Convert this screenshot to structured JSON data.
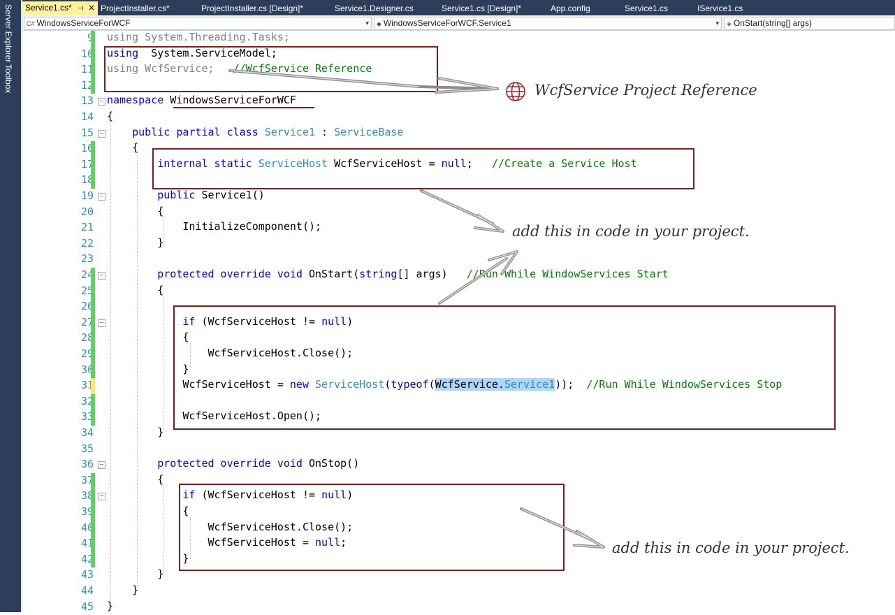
{
  "dock": {
    "server_explorer": "Server Explorer",
    "toolbox": "Toolbox"
  },
  "tabs": [
    {
      "label": "Service1.cs*",
      "active": true
    },
    {
      "label": "ProjectInstaller.cs*"
    },
    {
      "label": "ProjectInstaller.cs [Design]*"
    },
    {
      "label": "Service1.Designer.cs"
    },
    {
      "label": "Service1.cs [Design]*"
    },
    {
      "label": "App.config"
    },
    {
      "label": "Service1.cs"
    },
    {
      "label": "IService1.cs"
    }
  ],
  "tab_pin": "⊣",
  "tab_close": "✕",
  "nav": {
    "project": "WindowsServiceForWCF",
    "class": "WindowsServiceForWCF.Service1",
    "member": "OnStart(string[] args)"
  },
  "lines": [
    {
      "n": "9",
      "code": [
        [
          "gy",
          "using System.Threading.Tasks;"
        ]
      ]
    },
    {
      "n": "10",
      "code": [
        [
          "kw",
          "using"
        ],
        [
          "",
          "  System.ServiceModel;"
        ]
      ]
    },
    {
      "n": "11",
      "code": [
        [
          "gy",
          "using WcfService;"
        ],
        [
          "",
          "   "
        ],
        [
          "cm",
          "//WcfService Reference"
        ]
      ]
    },
    {
      "n": "12",
      "code": []
    },
    {
      "n": "13",
      "code": [
        [
          "kw",
          "namespace"
        ],
        [
          "",
          " WindowsServiceForWCF"
        ]
      ]
    },
    {
      "n": "14",
      "code": [
        [
          "",
          "{"
        ]
      ]
    },
    {
      "n": "15",
      "code": [
        [
          "",
          "    "
        ],
        [
          "kw",
          "public partial class"
        ],
        [
          "",
          " "
        ],
        [
          "ty",
          "Service1"
        ],
        [
          "",
          " : "
        ],
        [
          "ty",
          "ServiceBase"
        ]
      ]
    },
    {
      "n": "16",
      "code": [
        [
          "",
          "    {"
        ]
      ]
    },
    {
      "n": "17",
      "code": [
        [
          "",
          "        "
        ],
        [
          "kw",
          "internal static"
        ],
        [
          "",
          " "
        ],
        [
          "ty",
          "ServiceHost"
        ],
        [
          "",
          " WcfServiceHost = "
        ],
        [
          "kw",
          "null"
        ],
        [
          "",
          ";   "
        ],
        [
          "cm",
          "//Create a Service Host"
        ]
      ]
    },
    {
      "n": "18",
      "code": []
    },
    {
      "n": "19",
      "code": [
        [
          "",
          "        "
        ],
        [
          "kw",
          "public"
        ],
        [
          "",
          " Service1()"
        ]
      ]
    },
    {
      "n": "20",
      "code": [
        [
          "",
          "        {"
        ]
      ]
    },
    {
      "n": "21",
      "code": [
        [
          "",
          "            InitializeComponent();"
        ]
      ]
    },
    {
      "n": "22",
      "code": [
        [
          "",
          "        }"
        ]
      ]
    },
    {
      "n": "23",
      "code": []
    },
    {
      "n": "24",
      "code": [
        [
          "",
          "        "
        ],
        [
          "kw",
          "protected override void"
        ],
        [
          "",
          " OnStart("
        ],
        [
          "kw",
          "string"
        ],
        [
          "",
          "[] args)   "
        ],
        [
          "cm",
          "//Run While WindowServices Start"
        ]
      ]
    },
    {
      "n": "25",
      "code": [
        [
          "",
          "        {"
        ]
      ]
    },
    {
      "n": "26",
      "code": []
    },
    {
      "n": "27",
      "code": [
        [
          "",
          "            "
        ],
        [
          "kw",
          "if"
        ],
        [
          "",
          " (WcfServiceHost != "
        ],
        [
          "kw",
          "null"
        ],
        [
          "",
          ")"
        ]
      ]
    },
    {
      "n": "28",
      "code": [
        [
          "",
          "            {"
        ]
      ]
    },
    {
      "n": "29",
      "code": [
        [
          "",
          "                WcfServiceHost.Close();"
        ]
      ]
    },
    {
      "n": "30",
      "code": [
        [
          "",
          "            }"
        ]
      ]
    },
    {
      "n": "31",
      "code": [
        [
          "",
          "            WcfServiceHost = "
        ],
        [
          "kw",
          "new"
        ],
        [
          "",
          " "
        ],
        [
          "ty",
          "ServiceHost"
        ],
        [
          "",
          "("
        ],
        [
          "kw",
          "typeof"
        ],
        [
          "",
          "("
        ],
        [
          "hl",
          "WcfService."
        ],
        [
          "hlty",
          "Service1"
        ],
        [
          "",
          "));  "
        ],
        [
          "cm",
          "//Run While WindowServices Stop"
        ]
      ]
    },
    {
      "n": "32",
      "code": []
    },
    {
      "n": "33",
      "code": [
        [
          "",
          "            WcfServiceHost.Open();"
        ]
      ]
    },
    {
      "n": "34",
      "code": [
        [
          "",
          "        }"
        ]
      ]
    },
    {
      "n": "35",
      "code": []
    },
    {
      "n": "36",
      "code": [
        [
          "",
          "        "
        ],
        [
          "kw",
          "protected override void"
        ],
        [
          "",
          " OnStop()"
        ]
      ]
    },
    {
      "n": "37",
      "code": [
        [
          "",
          "        {"
        ]
      ]
    },
    {
      "n": "38",
      "code": [
        [
          "",
          "            "
        ],
        [
          "kw",
          "if"
        ],
        [
          "",
          " (WcfServiceHost != "
        ],
        [
          "kw",
          "null"
        ],
        [
          "",
          ")"
        ]
      ]
    },
    {
      "n": "39",
      "code": [
        [
          "",
          "            {"
        ]
      ]
    },
    {
      "n": "40",
      "code": [
        [
          "",
          "                WcfServiceHost.Close();"
        ]
      ]
    },
    {
      "n": "41",
      "code": [
        [
          "",
          "                WcfServiceHost = "
        ],
        [
          "kw",
          "null"
        ],
        [
          "",
          ";"
        ]
      ]
    },
    {
      "n": "42",
      "code": [
        [
          "",
          "            }"
        ]
      ]
    },
    {
      "n": "43",
      "code": [
        [
          "",
          "        }"
        ]
      ]
    },
    {
      "n": "44",
      "code": [
        [
          "",
          "    }"
        ]
      ]
    },
    {
      "n": "45",
      "code": [
        [
          "",
          "}"
        ]
      ]
    }
  ],
  "annotations": {
    "reference": "WcfService Project Reference",
    "add_code_1": "add this in code in your project.",
    "add_code_2": "add this in code in your project."
  },
  "colors": {
    "keyword": "#0000ff",
    "type": "#2b91af",
    "comment": "#008000",
    "annotation_box": "#8b1a1a",
    "change_saved": "#5fd15f",
    "change_unsaved": "#f5ea6f",
    "ide_chrome": "#2d3e5b"
  }
}
